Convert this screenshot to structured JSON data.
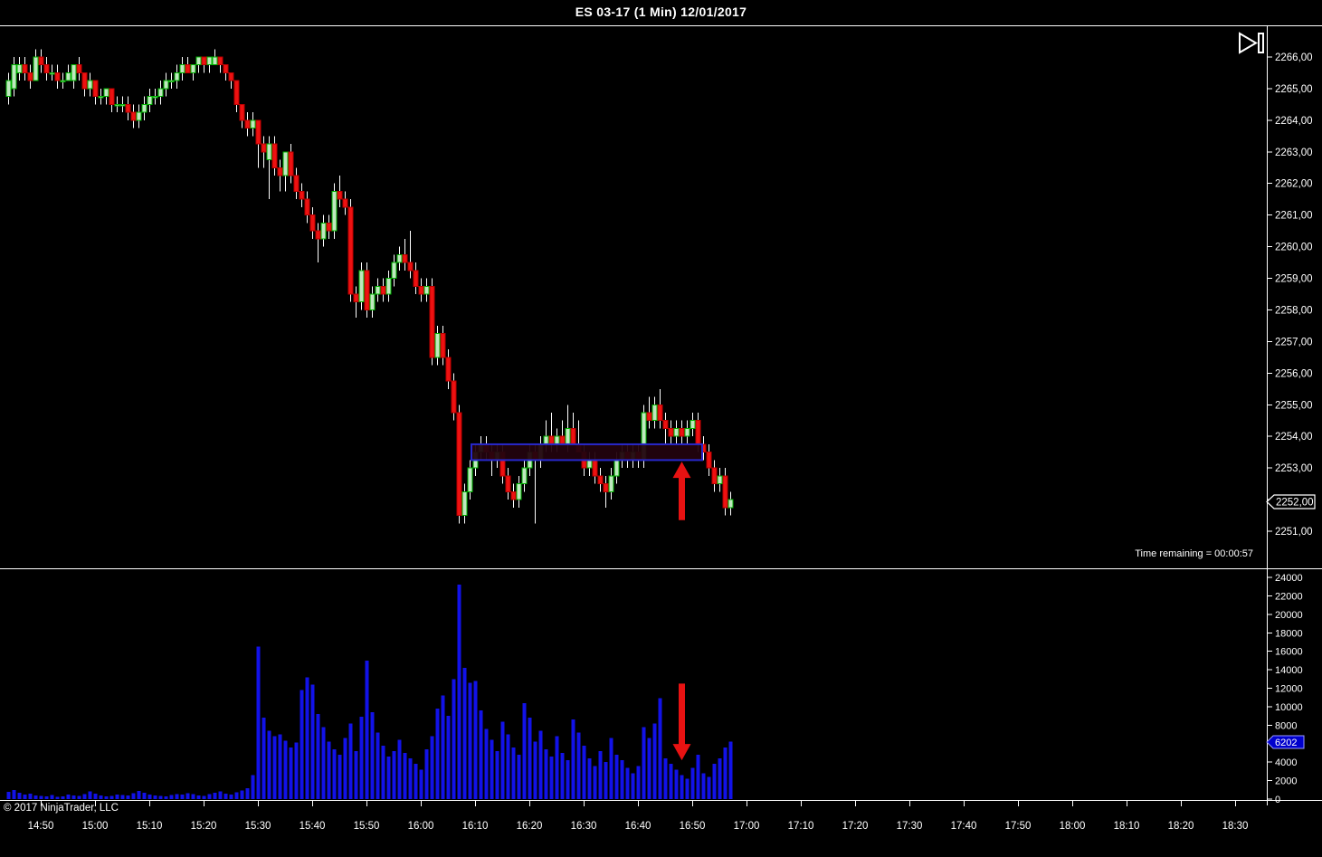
{
  "window": {
    "title": "ES 03-17 (1 Min)  12/01/2017",
    "copyright": "© 2017 NinjaTrader, LLC",
    "time_remaining": "Time remaining = 00:00:57"
  },
  "price_axis": {
    "labels": [
      "2266,00",
      "2265,00",
      "2264,00",
      "2263,00",
      "2262,00",
      "2261,00",
      "2260,00",
      "2259,00",
      "2258,00",
      "2257,00",
      "2256,00",
      "2255,00",
      "2254,00",
      "2253,00",
      "2252,00",
      "2251,00"
    ],
    "last_price_marker": "2252,00",
    "last_price_value": 2252.0
  },
  "volume_axis": {
    "labels": [
      "24000",
      "22000",
      "20000",
      "18000",
      "16000",
      "14000",
      "12000",
      "10000",
      "8000",
      "6202",
      "4000",
      "2000",
      "0"
    ],
    "tick_labels": [
      "24000",
      "22000",
      "20000",
      "18000",
      "16000",
      "14000",
      "12000",
      "10000",
      "8000",
      "4000",
      "2000",
      "0"
    ],
    "last_volume_marker": "6202",
    "last_volume_value": 6202
  },
  "time_axis": {
    "labels": [
      "14:50",
      "15:00",
      "15:10",
      "15:20",
      "15:30",
      "15:40",
      "15:50",
      "16:00",
      "16:10",
      "16:20",
      "16:30",
      "16:40",
      "16:50",
      "17:00",
      "17:10",
      "17:20",
      "17:30",
      "17:40",
      "17:50",
      "18:00",
      "18:10",
      "18:20",
      "18:30"
    ]
  },
  "chart_data": {
    "type": "candlestick+volume",
    "instrument": "ES 03-17",
    "interval": "1 Min",
    "date": "12/01/2017",
    "price_range_visible": [
      2250.6,
      2266.7
    ],
    "volume_range": [
      0,
      24000
    ],
    "legend_position": "none",
    "grid": "off",
    "columns": [
      "time",
      "open",
      "high",
      "low",
      "close",
      "volume"
    ],
    "candles": [
      [
        "14:44",
        2264.75,
        2265.5,
        2264.5,
        2265.25,
        800
      ],
      [
        "14:45",
        2265.0,
        2266.0,
        2264.75,
        2265.75,
        1000
      ],
      [
        "14:46",
        2265.5,
        2266.0,
        2265.25,
        2265.75,
        700
      ],
      [
        "14:47",
        2265.75,
        2266.0,
        2265.25,
        2265.5,
        500
      ],
      [
        "14:48",
        2265.5,
        2265.75,
        2265.0,
        2265.25,
        600
      ],
      [
        "14:49",
        2265.25,
        2266.25,
        2265.25,
        2266.0,
        400
      ],
      [
        "14:50",
        2266.0,
        2266.25,
        2265.5,
        2265.75,
        350
      ],
      [
        "14:51",
        2265.75,
        2266.0,
        2265.25,
        2265.5,
        300
      ],
      [
        "14:52",
        2265.5,
        2265.75,
        2265.25,
        2265.5,
        450
      ],
      [
        "14:53",
        2265.5,
        2265.75,
        2265.0,
        2265.25,
        250
      ],
      [
        "14:54",
        2265.25,
        2265.5,
        2265.0,
        2265.25,
        300
      ],
      [
        "14:55",
        2265.25,
        2265.75,
        2265.25,
        2265.5,
        500
      ],
      [
        "14:56",
        2265.25,
        2265.75,
        2265.0,
        2265.75,
        400
      ],
      [
        "14:57",
        2265.75,
        2266.0,
        2265.25,
        2265.5,
        350
      ],
      [
        "14:58",
        2265.5,
        2265.5,
        2264.75,
        2265.0,
        550
      ],
      [
        "14:59",
        2265.0,
        2265.5,
        2264.75,
        2265.25,
        850
      ],
      [
        "15:00",
        2265.25,
        2265.25,
        2264.5,
        2264.75,
        600
      ],
      [
        "15:01",
        2264.75,
        2265.0,
        2264.5,
        2264.75,
        400
      ],
      [
        "15:02",
        2264.75,
        2265.0,
        2264.5,
        2265.0,
        300
      ],
      [
        "15:03",
        2265.0,
        2265.0,
        2264.25,
        2264.5,
        350
      ],
      [
        "15:04",
        2264.5,
        2264.75,
        2264.25,
        2264.5,
        500
      ],
      [
        "15:05",
        2264.5,
        2264.75,
        2264.25,
        2264.5,
        450
      ],
      [
        "15:06",
        2264.5,
        2264.75,
        2264.0,
        2264.25,
        400
      ],
      [
        "15:07",
        2264.25,
        2264.5,
        2263.75,
        2264.0,
        650
      ],
      [
        "15:08",
        2264.0,
        2264.5,
        2263.75,
        2264.25,
        900
      ],
      [
        "15:09",
        2264.25,
        2264.75,
        2264.0,
        2264.5,
        700
      ],
      [
        "15:10",
        2264.5,
        2265.0,
        2264.25,
        2264.75,
        500
      ],
      [
        "15:11",
        2264.75,
        2265.0,
        2264.5,
        2264.75,
        400
      ],
      [
        "15:12",
        2264.75,
        2265.25,
        2264.5,
        2265.0,
        350
      ],
      [
        "15:13",
        2265.0,
        2265.5,
        2264.75,
        2265.25,
        300
      ],
      [
        "15:14",
        2265.25,
        2265.5,
        2265.0,
        2265.25,
        420
      ],
      [
        "15:15",
        2265.25,
        2265.75,
        2265.0,
        2265.5,
        560
      ],
      [
        "15:16",
        2265.5,
        2266.0,
        2265.25,
        2265.75,
        480
      ],
      [
        "15:17",
        2265.75,
        2266.0,
        2265.5,
        2265.5,
        620
      ],
      [
        "15:18",
        2265.5,
        2265.75,
        2265.25,
        2265.75,
        520
      ],
      [
        "15:19",
        2265.75,
        2266.0,
        2265.5,
        2266.0,
        400
      ],
      [
        "15:20",
        2266.0,
        2266.0,
        2265.5,
        2265.75,
        350
      ],
      [
        "15:21",
        2265.75,
        2266.0,
        2265.5,
        2266.0,
        520
      ],
      [
        "15:22",
        2265.75,
        2266.25,
        2265.75,
        2266.0,
        680
      ],
      [
        "15:23",
        2266.0,
        2266.0,
        2265.5,
        2265.75,
        820
      ],
      [
        "15:24",
        2265.75,
        2265.75,
        2265.25,
        2265.5,
        600
      ],
      [
        "15:25",
        2265.5,
        2265.5,
        2265.0,
        2265.25,
        480
      ],
      [
        "15:26",
        2265.25,
        2265.25,
        2264.25,
        2264.5,
        750
      ],
      [
        "15:27",
        2264.5,
        2264.5,
        2263.75,
        2264.0,
        950
      ],
      [
        "15:28",
        2264.0,
        2264.25,
        2263.5,
        2263.75,
        1200
      ],
      [
        "15:29",
        2263.75,
        2264.25,
        2263.5,
        2264.0,
        2600
      ],
      [
        "15:30",
        2264.0,
        2264.0,
        2262.5,
        2263.25,
        16500
      ],
      [
        "15:31",
        2263.25,
        2263.5,
        2262.5,
        2263.0,
        8800
      ],
      [
        "15:32",
        2262.75,
        2263.5,
        2261.5,
        2263.25,
        7400
      ],
      [
        "15:33",
        2263.25,
        2263.5,
        2262.25,
        2262.5,
        6800
      ],
      [
        "15:34",
        2262.5,
        2262.75,
        2261.75,
        2262.25,
        7000
      ],
      [
        "15:35",
        2262.25,
        2263.0,
        2261.75,
        2263.0,
        6300
      ],
      [
        "15:36",
        2263.0,
        2263.25,
        2262.0,
        2262.25,
        5600
      ],
      [
        "15:37",
        2262.25,
        2262.5,
        2261.5,
        2261.75,
        6100
      ],
      [
        "15:38",
        2261.75,
        2262.0,
        2261.25,
        2261.5,
        11800
      ],
      [
        "15:39",
        2261.5,
        2261.75,
        2260.75,
        2261.0,
        13200
      ],
      [
        "15:40",
        2261.0,
        2261.25,
        2260.25,
        2260.5,
        12400
      ],
      [
        "15:41",
        2260.5,
        2260.75,
        2259.5,
        2260.25,
        9200
      ],
      [
        "15:42",
        2260.25,
        2261.0,
        2260.0,
        2260.75,
        7800
      ],
      [
        "15:43",
        2260.75,
        2261.0,
        2260.25,
        2260.5,
        6200
      ],
      [
        "15:44",
        2260.5,
        2262.0,
        2260.25,
        2261.75,
        5400
      ],
      [
        "15:45",
        2261.75,
        2262.25,
        2261.25,
        2261.5,
        4800
      ],
      [
        "15:46",
        2261.5,
        2261.75,
        2261.0,
        2261.25,
        6600
      ],
      [
        "15:47",
        2261.25,
        2261.5,
        2258.25,
        2258.5,
        8200
      ],
      [
        "15:48",
        2258.5,
        2258.75,
        2257.75,
        2258.25,
        5200
      ],
      [
        "15:49",
        2258.25,
        2259.5,
        2258.0,
        2259.25,
        8900
      ],
      [
        "15:50",
        2259.25,
        2259.5,
        2257.75,
        2258.0,
        15000
      ],
      [
        "15:51",
        2258.0,
        2258.75,
        2257.75,
        2258.5,
        9400
      ],
      [
        "15:52",
        2258.5,
        2259.0,
        2258.25,
        2258.75,
        7200
      ],
      [
        "15:53",
        2258.75,
        2259.0,
        2258.25,
        2258.5,
        5800
      ],
      [
        "15:54",
        2258.5,
        2259.25,
        2258.25,
        2259.0,
        4600
      ],
      [
        "15:55",
        2259.0,
        2259.75,
        2258.75,
        2259.5,
        5200
      ],
      [
        "15:56",
        2259.5,
        2260.0,
        2259.25,
        2259.75,
        6400
      ],
      [
        "15:57",
        2259.75,
        2260.25,
        2259.25,
        2259.5,
        5000
      ],
      [
        "15:58",
        2259.5,
        2260.5,
        2259.0,
        2259.25,
        4400
      ],
      [
        "15:59",
        2259.25,
        2259.5,
        2258.5,
        2258.75,
        3800
      ],
      [
        "16:00",
        2258.75,
        2259.0,
        2258.25,
        2258.5,
        3200
      ],
      [
        "16:01",
        2258.5,
        2259.0,
        2258.25,
        2258.75,
        5400
      ],
      [
        "16:02",
        2258.75,
        2259.0,
        2256.25,
        2256.5,
        6800
      ],
      [
        "16:03",
        2256.5,
        2257.5,
        2256.25,
        2257.25,
        9800
      ],
      [
        "16:04",
        2257.25,
        2257.5,
        2256.25,
        2256.5,
        11200
      ],
      [
        "16:05",
        2256.5,
        2256.75,
        2255.5,
        2255.75,
        9000
      ],
      [
        "16:06",
        2255.75,
        2256.0,
        2254.5,
        2254.75,
        13000
      ],
      [
        "16:07",
        2254.75,
        2255.0,
        2251.25,
        2251.5,
        23200
      ],
      [
        "16:08",
        2251.5,
        2252.5,
        2251.25,
        2252.25,
        14200
      ],
      [
        "16:09",
        2252.25,
        2253.25,
        2252.0,
        2253.0,
        12600
      ],
      [
        "16:10",
        2253.0,
        2253.75,
        2252.75,
        2253.5,
        12800
      ],
      [
        "16:11",
        2253.5,
        2254.0,
        2253.25,
        2253.75,
        9600
      ],
      [
        "16:12",
        2253.75,
        2254.0,
        2253.25,
        2253.5,
        7600
      ],
      [
        "16:13",
        2253.5,
        2253.75,
        2252.75,
        2253.25,
        6400
      ],
      [
        "16:14",
        2253.25,
        2253.75,
        2253.0,
        2253.5,
        5200
      ],
      [
        "16:15",
        2253.5,
        2253.75,
        2252.5,
        2252.75,
        8400
      ],
      [
        "16:16",
        2252.75,
        2253.0,
        2252.0,
        2252.25,
        7000
      ],
      [
        "16:17",
        2252.25,
        2252.5,
        2251.75,
        2252.0,
        5600
      ],
      [
        "16:18",
        2252.0,
        2252.75,
        2251.75,
        2252.5,
        4800
      ],
      [
        "16:19",
        2252.5,
        2253.25,
        2252.25,
        2253.0,
        10400
      ],
      [
        "16:20",
        2253.0,
        2253.75,
        2252.75,
        2253.5,
        8800
      ],
      [
        "16:21",
        2253.5,
        2253.75,
        2251.25,
        2253.25,
        6200
      ],
      [
        "16:22",
        2253.25,
        2254.0,
        2253.0,
        2253.75,
        7400
      ],
      [
        "16:23",
        2253.75,
        2254.5,
        2253.5,
        2254.0,
        5400
      ],
      [
        "16:24",
        2254.0,
        2254.75,
        2253.5,
        2253.75,
        4600
      ],
      [
        "16:25",
        2253.75,
        2254.25,
        2253.5,
        2254.0,
        6800
      ],
      [
        "16:26",
        2254.0,
        2254.5,
        2253.75,
        2253.75,
        5000
      ],
      [
        "16:27",
        2253.75,
        2255.0,
        2253.5,
        2254.25,
        4200
      ],
      [
        "16:28",
        2254.25,
        2254.75,
        2253.75,
        2253.75,
        8600
      ],
      [
        "16:29",
        2253.75,
        2254.5,
        2253.5,
        2253.5,
        7200
      ],
      [
        "16:30",
        2253.5,
        2253.75,
        2252.75,
        2253.0,
        5800
      ],
      [
        "16:31",
        2253.0,
        2253.5,
        2252.75,
        2253.25,
        4400
      ],
      [
        "16:32",
        2253.25,
        2253.5,
        2252.5,
        2252.75,
        3600
      ],
      [
        "16:33",
        2252.75,
        2253.0,
        2252.25,
        2252.5,
        5200
      ],
      [
        "16:34",
        2252.5,
        2252.75,
        2251.75,
        2252.25,
        4000
      ],
      [
        "16:35",
        2252.25,
        2253.0,
        2252.0,
        2252.75,
        6600
      ],
      [
        "16:36",
        2252.75,
        2253.5,
        2252.5,
        2253.25,
        4800
      ],
      [
        "16:37",
        2253.25,
        2253.75,
        2253.0,
        2253.5,
        4200
      ],
      [
        "16:38",
        2253.5,
        2253.75,
        2253.0,
        2253.25,
        3400
      ],
      [
        "16:39",
        2253.25,
        2253.75,
        2253.0,
        2253.5,
        2800
      ],
      [
        "16:40",
        2253.5,
        2253.75,
        2253.0,
        2253.25,
        3600
      ],
      [
        "16:41",
        2253.25,
        2255.0,
        2253.0,
        2254.75,
        7800
      ],
      [
        "16:42",
        2254.75,
        2255.25,
        2254.25,
        2254.5,
        6600
      ],
      [
        "16:43",
        2254.5,
        2255.25,
        2254.25,
        2255.0,
        8200
      ],
      [
        "16:44",
        2255.0,
        2255.5,
        2254.25,
        2254.5,
        10900
      ],
      [
        "16:45",
        2254.5,
        2254.75,
        2253.75,
        2254.25,
        4400
      ],
      [
        "16:46",
        2254.25,
        2254.5,
        2253.75,
        2254.0,
        3800
      ],
      [
        "16:47",
        2254.0,
        2254.5,
        2253.75,
        2254.25,
        3200
      ],
      [
        "16:48",
        2254.25,
        2254.5,
        2253.75,
        2254.0,
        2600
      ],
      [
        "16:49",
        2254.0,
        2254.5,
        2253.75,
        2254.25,
        2200
      ],
      [
        "16:50",
        2254.25,
        2254.75,
        2254.0,
        2254.5,
        3400
      ],
      [
        "16:51",
        2254.5,
        2254.75,
        2253.5,
        2253.75,
        4800
      ],
      [
        "16:52",
        2253.75,
        2254.0,
        2253.25,
        2253.5,
        2800
      ],
      [
        "16:53",
        2253.5,
        2253.75,
        2252.75,
        2253.0,
        2400
      ],
      [
        "16:54",
        2253.0,
        2253.25,
        2252.25,
        2252.5,
        3800
      ],
      [
        "16:55",
        2252.5,
        2253.0,
        2252.25,
        2252.75,
        4400
      ],
      [
        "16:56",
        2252.75,
        2253.0,
        2251.5,
        2251.75,
        5600
      ],
      [
        "16:57",
        2251.75,
        2252.25,
        2251.5,
        2252.0,
        6202
      ]
    ],
    "rectangle": {
      "start_time": "16:10",
      "end_time": "16:51",
      "top_price": 2253.75,
      "bottom_price": 2253.25,
      "border_color": "#2828cc",
      "fill_color": "#22030e"
    },
    "arrows": [
      {
        "panel": "price",
        "time": "16:48",
        "direction": "up",
        "tip_price": 2253.2,
        "tail_price": 2251.35,
        "color": "#e81212"
      },
      {
        "panel": "volume",
        "time": "16:48",
        "direction": "down",
        "tail_value": 12500,
        "tip_value": 4200,
        "color": "#e81212"
      }
    ],
    "colors": {
      "background": "#000000",
      "up_fill": "#bfe8bf",
      "up_stroke": "#00b300",
      "down_fill": "#ee1111",
      "down_stroke": "#bb0000",
      "wick": "#ffffff",
      "volume_bar": "#1212e8",
      "axis_text": "#ffffff",
      "axis_line": "#ffffff",
      "price_marker_bg": "#000000",
      "price_marker_border": "#ffffff",
      "volume_marker_bg": "#0000cc"
    }
  }
}
